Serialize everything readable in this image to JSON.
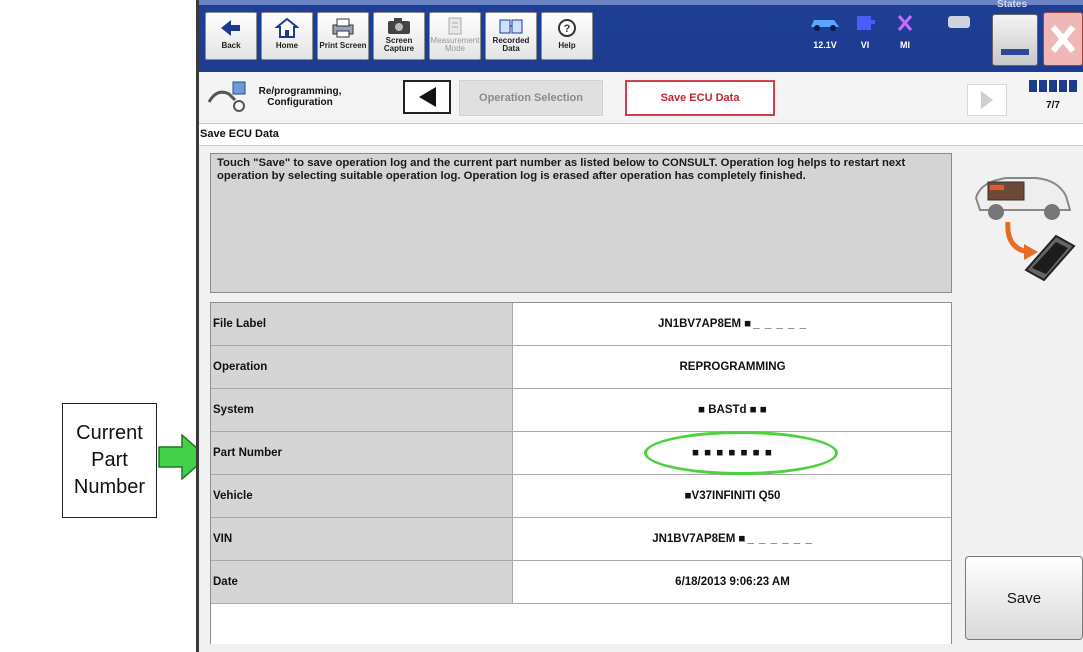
{
  "callout": {
    "lines": [
      "Current",
      "Part",
      "Number"
    ]
  },
  "toolbar": {
    "buttons": [
      {
        "label": "Back",
        "icon": "back-arrow-icon"
      },
      {
        "label": "Home",
        "icon": "home-icon"
      },
      {
        "label": "Print Screen",
        "icon": "printer-icon"
      },
      {
        "label": "Screen Capture",
        "icon": "camera-icon"
      },
      {
        "label": "Measurement Mode",
        "icon": "measurement-icon"
      },
      {
        "label": "Recorded Data",
        "icon": "recorded-data-icon"
      },
      {
        "label": "Help",
        "icon": "help-icon"
      }
    ],
    "status": {
      "battery": "12.1V",
      "vi": "VI",
      "mi": "MI"
    },
    "states_label": "States"
  },
  "breadcrumb": {
    "title": "Re/programming, Configuration",
    "previous_step": "Operation Selection",
    "current_step": "Save ECU Data",
    "page_indicator": "7/7",
    "progress_fraction": 1.0
  },
  "section_title": "Save ECU Data",
  "message": "Touch \"Save\" to save operation log and the current part number as listed below to CONSULT. Operation log helps to restart next operation by selecting suitable operation log. Operation log is erased after operation has completely finished.",
  "rows": [
    {
      "label": "File Label",
      "value": "JN1BV7AP8EM ■",
      "suffix": "_ _ _ _ _"
    },
    {
      "label": "Operation",
      "value": "REPROGRAMMING",
      "suffix": ""
    },
    {
      "label": "System",
      "value": "■ BASTd ■ ■",
      "suffix": ""
    },
    {
      "label": "Part Number",
      "value": "■ ■ ■ ■ ■ ■ ■",
      "suffix": ""
    },
    {
      "label": "Vehicle",
      "value": "■V37INFINITI Q50",
      "suffix": ""
    },
    {
      "label": "VIN",
      "value": "JN1BV7AP8EM ■",
      "suffix": "_ _ _ _ _ _"
    },
    {
      "label": "Date",
      "value": "6/18/2013 9:06:23 AM",
      "suffix": ""
    }
  ],
  "save_label": "Save",
  "colors": {
    "toolbar": "#1f3f95",
    "active_step": "#c1272d",
    "highlight": "#4cd23c",
    "arrow": "#44d14a"
  }
}
